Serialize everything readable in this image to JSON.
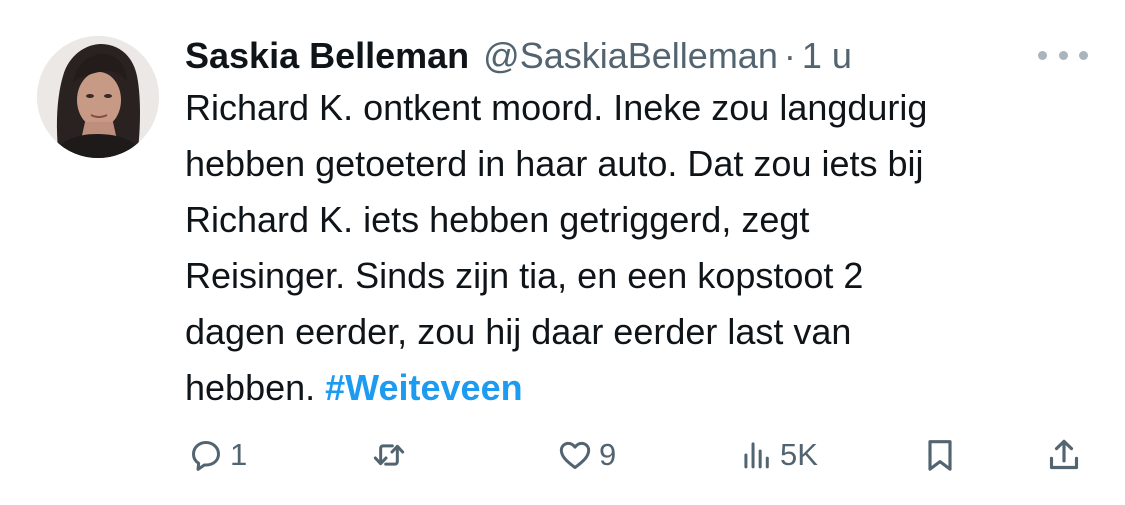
{
  "tweet": {
    "author_name": "Saskia Belleman",
    "handle": "@SaskiaBelleman",
    "separator": "·",
    "time": "1 u",
    "text_lines": [
      "Richard K. ontkent moord. Ineke zou langdurig",
      "hebben getoeterd in haar auto. Dat zou iets bij",
      "Richard K. iets hebben getriggerd, zegt",
      "Reisinger. Sinds zijn tia, en een kopstoot 2",
      "dagen eerder, zou hij daar eerder last van",
      "hebben. "
    ],
    "hashtag": "#Weiteveen"
  },
  "actions": {
    "reply": {
      "icon": "reply-icon",
      "count": "1"
    },
    "retweet": {
      "icon": "retweet-icon",
      "count": ""
    },
    "like": {
      "icon": "heart-icon",
      "count": "9"
    },
    "views": {
      "icon": "views-icon",
      "count": "5K"
    },
    "bookmark": {
      "icon": "bookmark-icon"
    },
    "share": {
      "icon": "share-icon"
    }
  },
  "colors": {
    "text": "#0f1419",
    "secondary": "#536471",
    "link": "#1d9bf0"
  }
}
